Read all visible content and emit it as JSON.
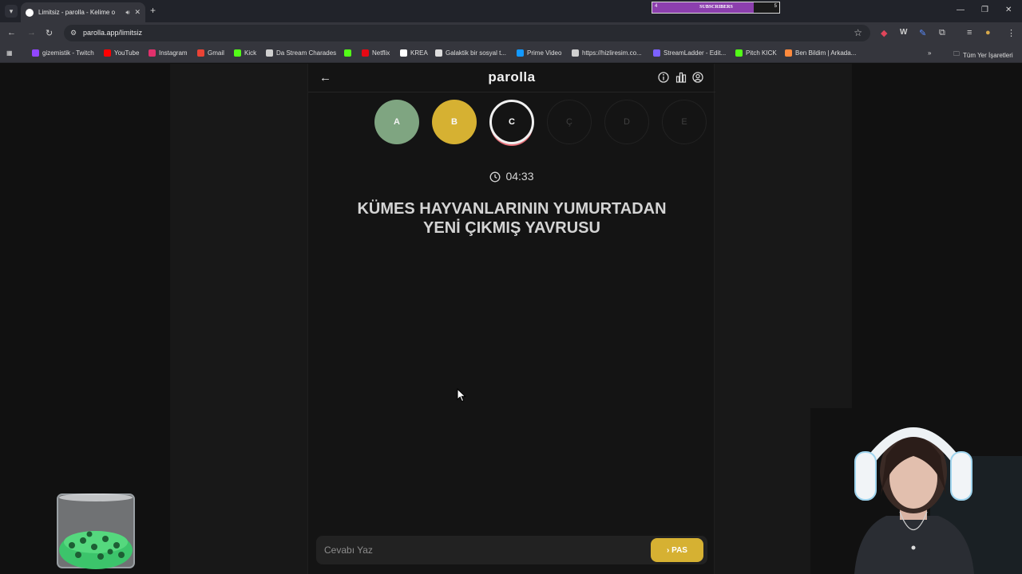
{
  "browser": {
    "tab": {
      "title": "Limitsiz - parolla - Kelime o",
      "audio_icon": "speaker-icon",
      "close_icon": "close-icon"
    },
    "new_tab_icon": "plus-icon",
    "url": "parolla.app/limitsiz",
    "bookmarks": [
      {
        "label": "gizemistik - Twitch",
        "color": "#9146ff"
      },
      {
        "label": "YouTube",
        "color": "#ff0000"
      },
      {
        "label": "Instagram",
        "color": "#e1306c"
      },
      {
        "label": "Gmail",
        "color": "#ea4335"
      },
      {
        "label": "Kick",
        "color": "#53fc18"
      },
      {
        "label": "Da Stream Charades",
        "color": "#cfcfcf"
      },
      {
        "label": "",
        "color": "#53fc18"
      },
      {
        "label": "Netflix",
        "color": "#e50914"
      },
      {
        "label": "KREA",
        "color": "#ffffff"
      },
      {
        "label": "Galaktik bir sosyal t...",
        "color": "#dddddd"
      },
      {
        "label": "Prime Video",
        "color": "#1399ff"
      },
      {
        "label": "https://hizliresim.co...",
        "color": "#cfcfcf"
      },
      {
        "label": "StreamLadder - Edit...",
        "color": "#7b61ff"
      },
      {
        "label": "Pitch KICK",
        "color": "#53fc18"
      },
      {
        "label": "Ben Bildim | Arkada...",
        "color": "#ff8a3d"
      }
    ],
    "all_bookmarks_label": "Tüm Yer İşaretleri"
  },
  "stream_widget": {
    "label": "SUBSCRIBERS",
    "current": "4",
    "goal": "5",
    "progress": 0.8
  },
  "game": {
    "logo": "parolla",
    "letters": [
      {
        "letter": "A",
        "state": "correct"
      },
      {
        "letter": "B",
        "state": "passed"
      },
      {
        "letter": "C",
        "state": "current"
      },
      {
        "letter": "Ç",
        "state": "pending"
      },
      {
        "letter": "D",
        "state": "pending"
      },
      {
        "letter": "E",
        "state": "pending"
      }
    ],
    "timer": "04:33",
    "question_line1": "KÜMES HAYVANLARININ YUMURTADAN",
    "question_line2": "YENİ ÇIKMIŞ YAVRUSU",
    "answer_placeholder": "Cevabı Yaz",
    "pass_button": "PAS"
  },
  "colors": {
    "correct": "#7fa581",
    "passed": "#d6b132",
    "current_ring": "#e8727b"
  }
}
